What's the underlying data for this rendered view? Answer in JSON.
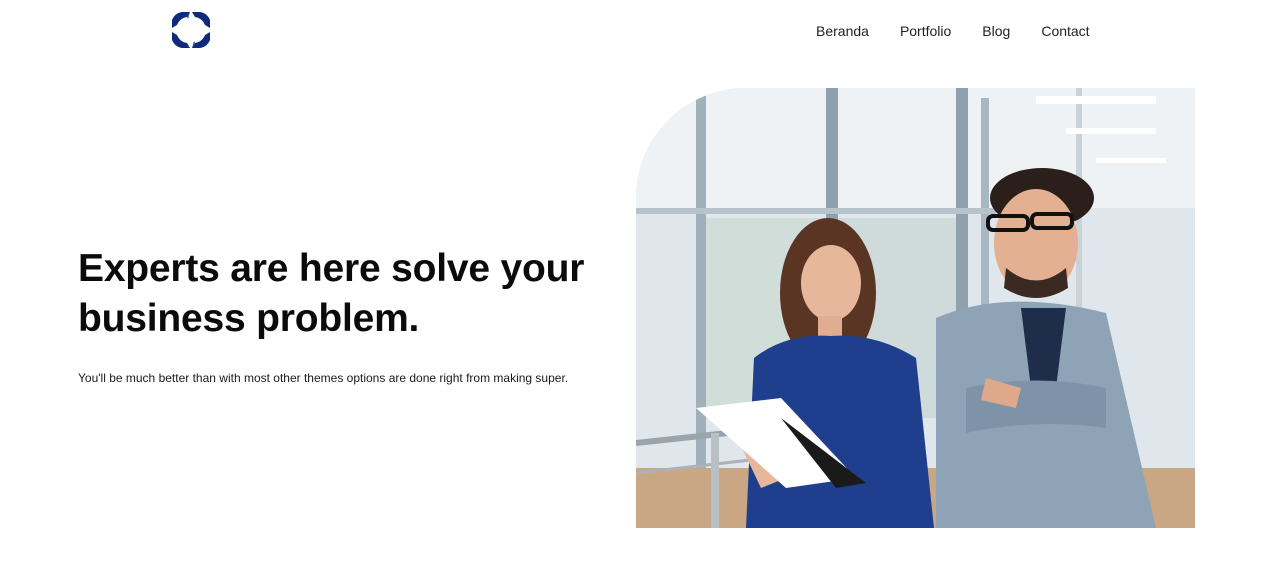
{
  "brand": {
    "logo": "four-arrows-logo",
    "color": "#0f2a7a"
  },
  "nav": {
    "items": [
      {
        "label": "Beranda"
      },
      {
        "label": "Portfolio"
      },
      {
        "label": "Blog"
      },
      {
        "label": "Contact"
      }
    ]
  },
  "hero": {
    "title": "Experts are here solve your business problem.",
    "subtitle": "You'll be much better than with most other themes options are done right from making super.",
    "image": "photo-two-colleagues-office"
  }
}
